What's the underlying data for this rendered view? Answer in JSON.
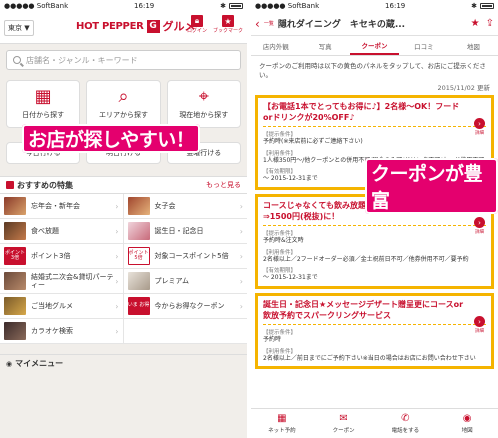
{
  "left": {
    "status": {
      "carrier": "●●●●● SoftBank",
      "time": "16:19",
      "battery": "⊕"
    },
    "header": {
      "area": "東京 ▼",
      "logo_text": "HOT PEPPER",
      "logo_box": "G",
      "logo_gourmet": "グルメ",
      "login_label": "ログイン",
      "bookmark_label": "ブックマーク"
    },
    "search": {
      "placeholder": "店舗名・ジャンル・キーワード"
    },
    "find": [
      {
        "icon": "▦",
        "label": "日付から探す"
      },
      {
        "icon": "⌕",
        "label": "エリアから探す"
      },
      {
        "icon": "⌖",
        "label": "現在地から探す"
      }
    ],
    "days": [
      "今日行ける",
      "明日行ける",
      "金曜行ける"
    ],
    "overlay": "お店が探しやすい！",
    "featured": {
      "title": "おすすめの特集",
      "more": "もっと見る"
    },
    "grid": [
      "忘年会・新年会",
      "女子会",
      "食べ放題",
      "誕生日・記念日",
      "ポイント3倍",
      "対象コースポイント5倍",
      "結婚式二次会&貸切パーティー",
      "プレミアム",
      "ご当地グルメ",
      "今からお得なクーポン",
      "カラオケ検索",
      ""
    ],
    "thumb_texts": {
      "p3": "ポイント3倍",
      "p5": "ポイント5倍",
      "now": "いま お得"
    },
    "mymenu": "マイメニュー"
  },
  "right": {
    "status": {
      "carrier": "●●●●● SoftBank",
      "time": "16:19",
      "battery": "⊕"
    },
    "header": {
      "back": "‹",
      "back_label": "一覧",
      "title": "隠れダイニング　キセキの蔵..."
    },
    "tabs": [
      "店内外観",
      "写真",
      "クーポン",
      "口コミ",
      "地図"
    ],
    "intro": "クーポンのご利用時は以下の黄色のパネルをタップして、お店にご提示ください。",
    "date": "2015/11/02 更新",
    "overlay": "クーポンが豊富",
    "coupons": [
      {
        "title": "【お電話1本でとってもお得に♪】2名様～OK！フードorドリンクが20%OFF♪",
        "lines": [
          {
            "label": "【提示条件】",
            "value": "予約時(※来店前に必ずご連絡下さい)"
          },
          {
            "label": "【利用条件】",
            "value": "1人様350円～/他クーポンとの併用不可/現金のみ可/ドリンク不可/カード使用不可"
          },
          {
            "label": "【有効期限】",
            "value": "～ 2015-12-31まで"
          }
        ]
      },
      {
        "title": "コースじゃなくても飲み放題OK★2000円飲み放題⇒1500円(税抜)に！",
        "lines": [
          {
            "label": "【提示条件】",
            "value": "予約時&注文時"
          },
          {
            "label": "【利用条件】",
            "value": "2名様以上／2フードオーダー必須／金土祝前日不可／他券併用不可／要予約"
          },
          {
            "label": "【有効期限】",
            "value": "～ 2015-12-31まで"
          }
        ]
      },
      {
        "title": "誕生日・記念日★メッセージデザート贈呈更にコースor飲放予約でスパークリングサービス",
        "lines": [
          {
            "label": "【提示条件】",
            "value": "予約時"
          },
          {
            "label": "【利用条件】",
            "value": "2名様以上／前日までにご予約下さい※当日の場合はお店にお問い合わせ下さい"
          }
        ]
      }
    ],
    "detail_label": "詳細",
    "bottom_tabs": [
      {
        "icon": "▦",
        "label": "ネット予約"
      },
      {
        "icon": "✉",
        "label": "クーポン"
      },
      {
        "icon": "✆",
        "label": "電話をする"
      },
      {
        "icon": "◉",
        "label": "地図"
      }
    ]
  }
}
